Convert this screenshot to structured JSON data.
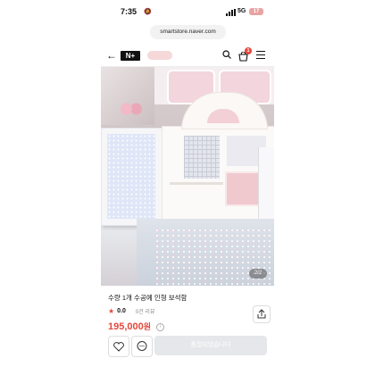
{
  "status_bar": {
    "time": "7:35",
    "network": "5G",
    "battery": "17"
  },
  "browser": {
    "url": "smartstore.naver.com"
  },
  "navbar": {
    "logo_text": "N+",
    "cart_badge": "1"
  },
  "photo": {
    "pager": "2/2"
  },
  "product": {
    "title": "수량 1개 수공예 인형 보석함",
    "rating": "0.0",
    "reviews": "0건 리뷰",
    "price": "195,000",
    "price_unit": "원"
  },
  "bottom_bar": {
    "soldout_label": "품절되었습니다"
  },
  "colors": {
    "accent": "#e6483b",
    "disabled_button": "#e5e7ea"
  }
}
